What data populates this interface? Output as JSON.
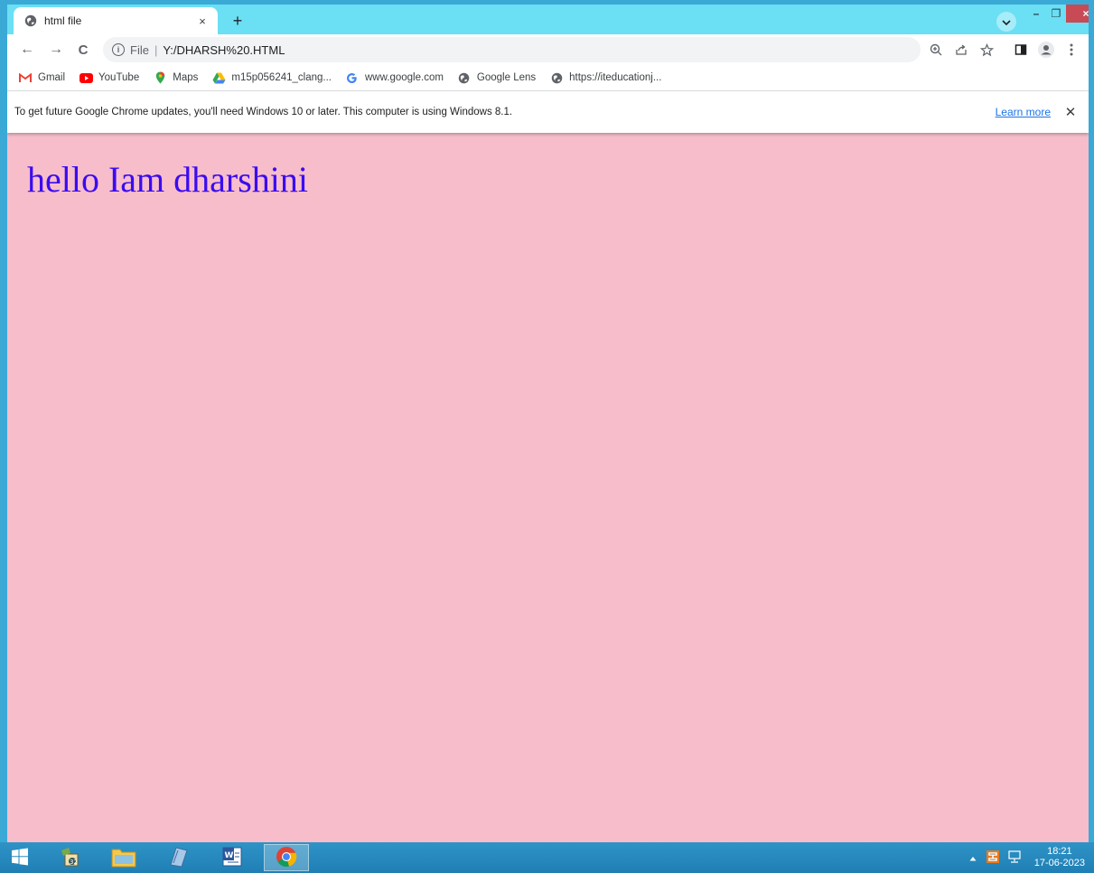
{
  "browser": {
    "tab": {
      "title": "html file",
      "close": "×"
    },
    "new_tab": "+",
    "window_controls": {
      "minimize": "–",
      "restore": "❐",
      "close": "×"
    }
  },
  "toolbar": {
    "back": "←",
    "forward": "→",
    "reload": "C",
    "address": {
      "info_glyph": "i",
      "scheme_label": "File",
      "separator": "|",
      "url": "Y:/DHARSH%20.HTML"
    }
  },
  "bookmarks": [
    {
      "label": "Gmail",
      "icon": "gmail-icon"
    },
    {
      "label": "YouTube",
      "icon": "youtube-icon"
    },
    {
      "label": "Maps",
      "icon": "maps-icon"
    },
    {
      "label": "m15p056241_clang...",
      "icon": "drive-icon"
    },
    {
      "label": "www.google.com",
      "icon": "google-icon"
    },
    {
      "label": "Google Lens",
      "icon": "globe-icon"
    },
    {
      "label": "https://iteducationj...",
      "icon": "globe-icon"
    }
  ],
  "infobar": {
    "message": "To get future Google Chrome updates, you'll need Windows 10 or later. This computer is using Windows 8.1.",
    "learn_more": "Learn more",
    "close": "✕"
  },
  "page": {
    "heading": "hello Iam dharshini",
    "background_color": "#f7bdcb",
    "text_color": "#3a0cf0"
  },
  "taskbar": {
    "clock_time": "18:21",
    "clock_date": "17-06-2023"
  },
  "colors": {
    "tabstrip": "#6bdff3",
    "taskbar": "#2f93c6",
    "link": "#1a73e8"
  }
}
